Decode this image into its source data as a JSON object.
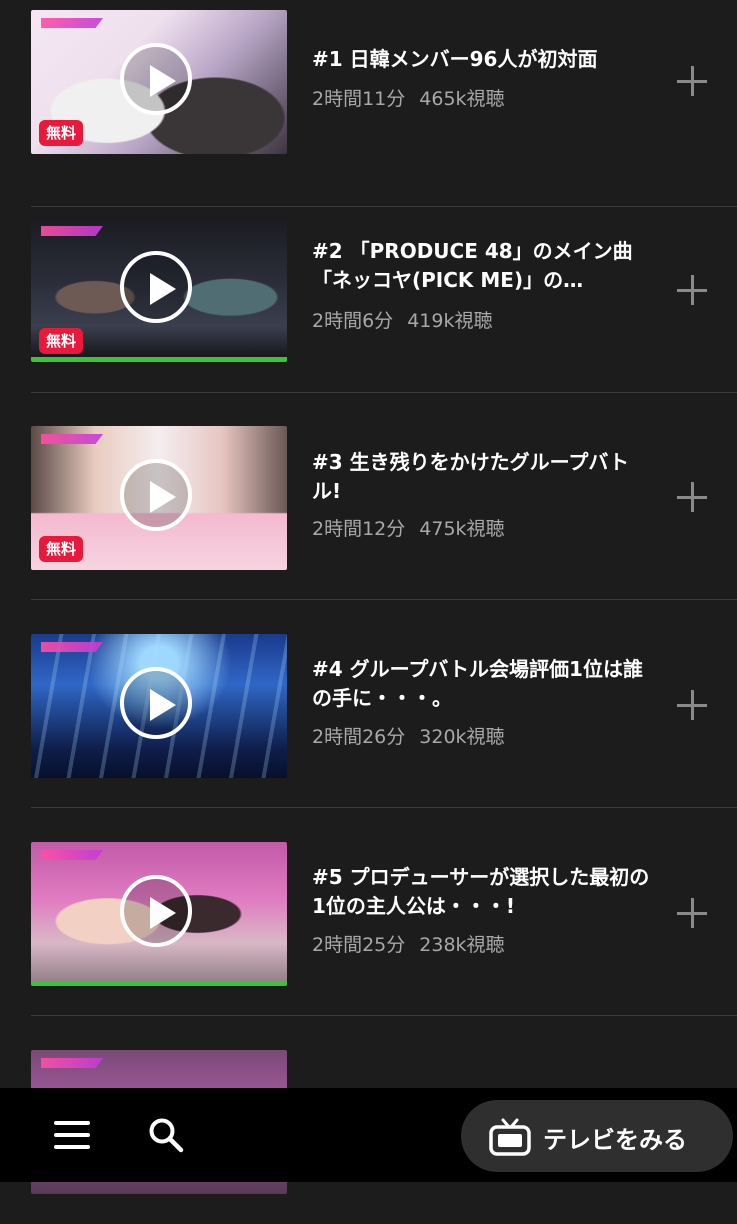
{
  "episodes": [
    {
      "title": "#1 日韓メンバー96人が初対面",
      "duration": "2時間11分",
      "views": "465k視聴",
      "badge": "無料",
      "progress": null
    },
    {
      "title": "#2 「PRODUCE 48」のメイン曲「ネッコヤ(PICK ME)」の…",
      "duration": "2時間6分",
      "views": "419k視聴",
      "badge": "無料",
      "progress": 1.0
    },
    {
      "title": "#3 生き残りをかけたグループバトル!",
      "duration": "2時間12分",
      "views": "475k視聴",
      "badge": "無料",
      "progress": null
    },
    {
      "title": "#4 グループバトル会場評価1位は誰の手に・・・。",
      "duration": "2時間26分",
      "views": "320k視聴",
      "badge": null,
      "progress": null
    },
    {
      "title": "#5 プロデューサーが選択した最初の1位の主人公は・・・!",
      "duration": "2時間25分",
      "views": "238k視聴",
      "badge": null,
      "progress": 1.0
    }
  ],
  "bottom_nav": {
    "menu_icon": "hamburger-menu-icon",
    "search_icon": "search-icon",
    "tv_button_icon": "tv-icon",
    "tv_button_label": "テレビをみる"
  },
  "colors": {
    "background": "#1c1c1c",
    "badge": "#e8193a",
    "progress": "#3bc43b",
    "meta_text": "#a8a8a8"
  }
}
